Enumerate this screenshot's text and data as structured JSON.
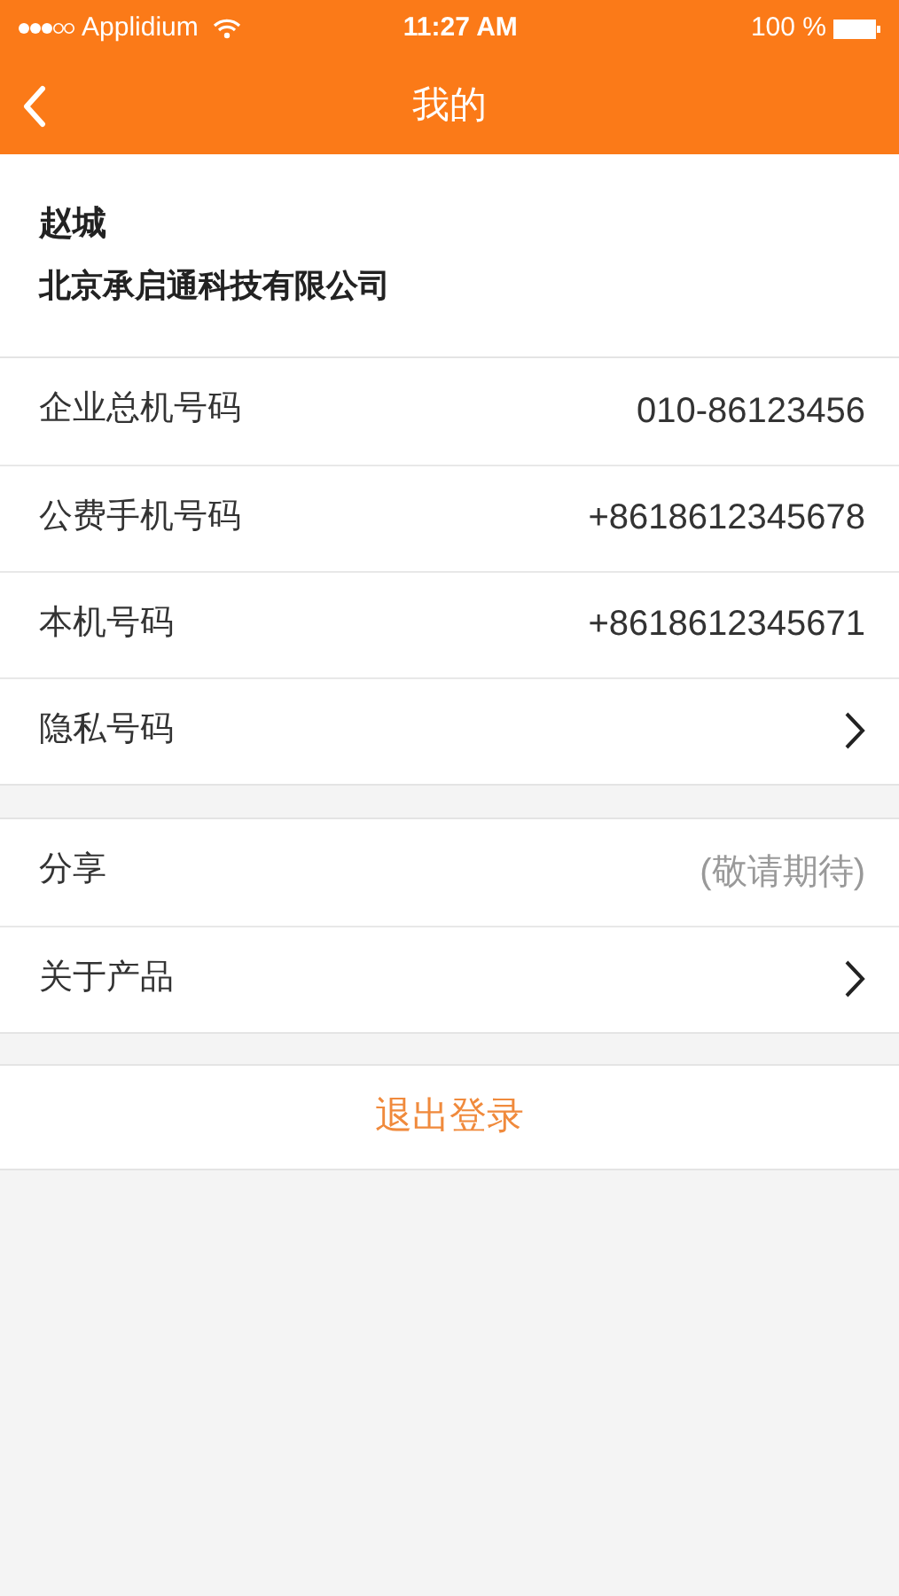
{
  "status_bar": {
    "carrier": "Applidium",
    "time": "11:27 AM",
    "battery": "100 %"
  },
  "nav": {
    "title": "我的"
  },
  "profile": {
    "name": "赵城",
    "company": "北京承启通科技有限公司"
  },
  "groups": [
    {
      "rows": [
        {
          "kind": "value",
          "label": "企业总机号码",
          "value": "010-86123456"
        },
        {
          "kind": "value",
          "label": "公费手机号码",
          "value": "+8618612345678"
        },
        {
          "kind": "value",
          "label": "本机号码",
          "value": "+8618612345671"
        },
        {
          "kind": "chevron",
          "label": "隐私号码"
        }
      ]
    },
    {
      "rows": [
        {
          "kind": "note",
          "label": "分享",
          "value": "(敬请期待)"
        },
        {
          "kind": "chevron",
          "label": "关于产品"
        }
      ]
    }
  ],
  "logout": {
    "label": "退出登录"
  }
}
